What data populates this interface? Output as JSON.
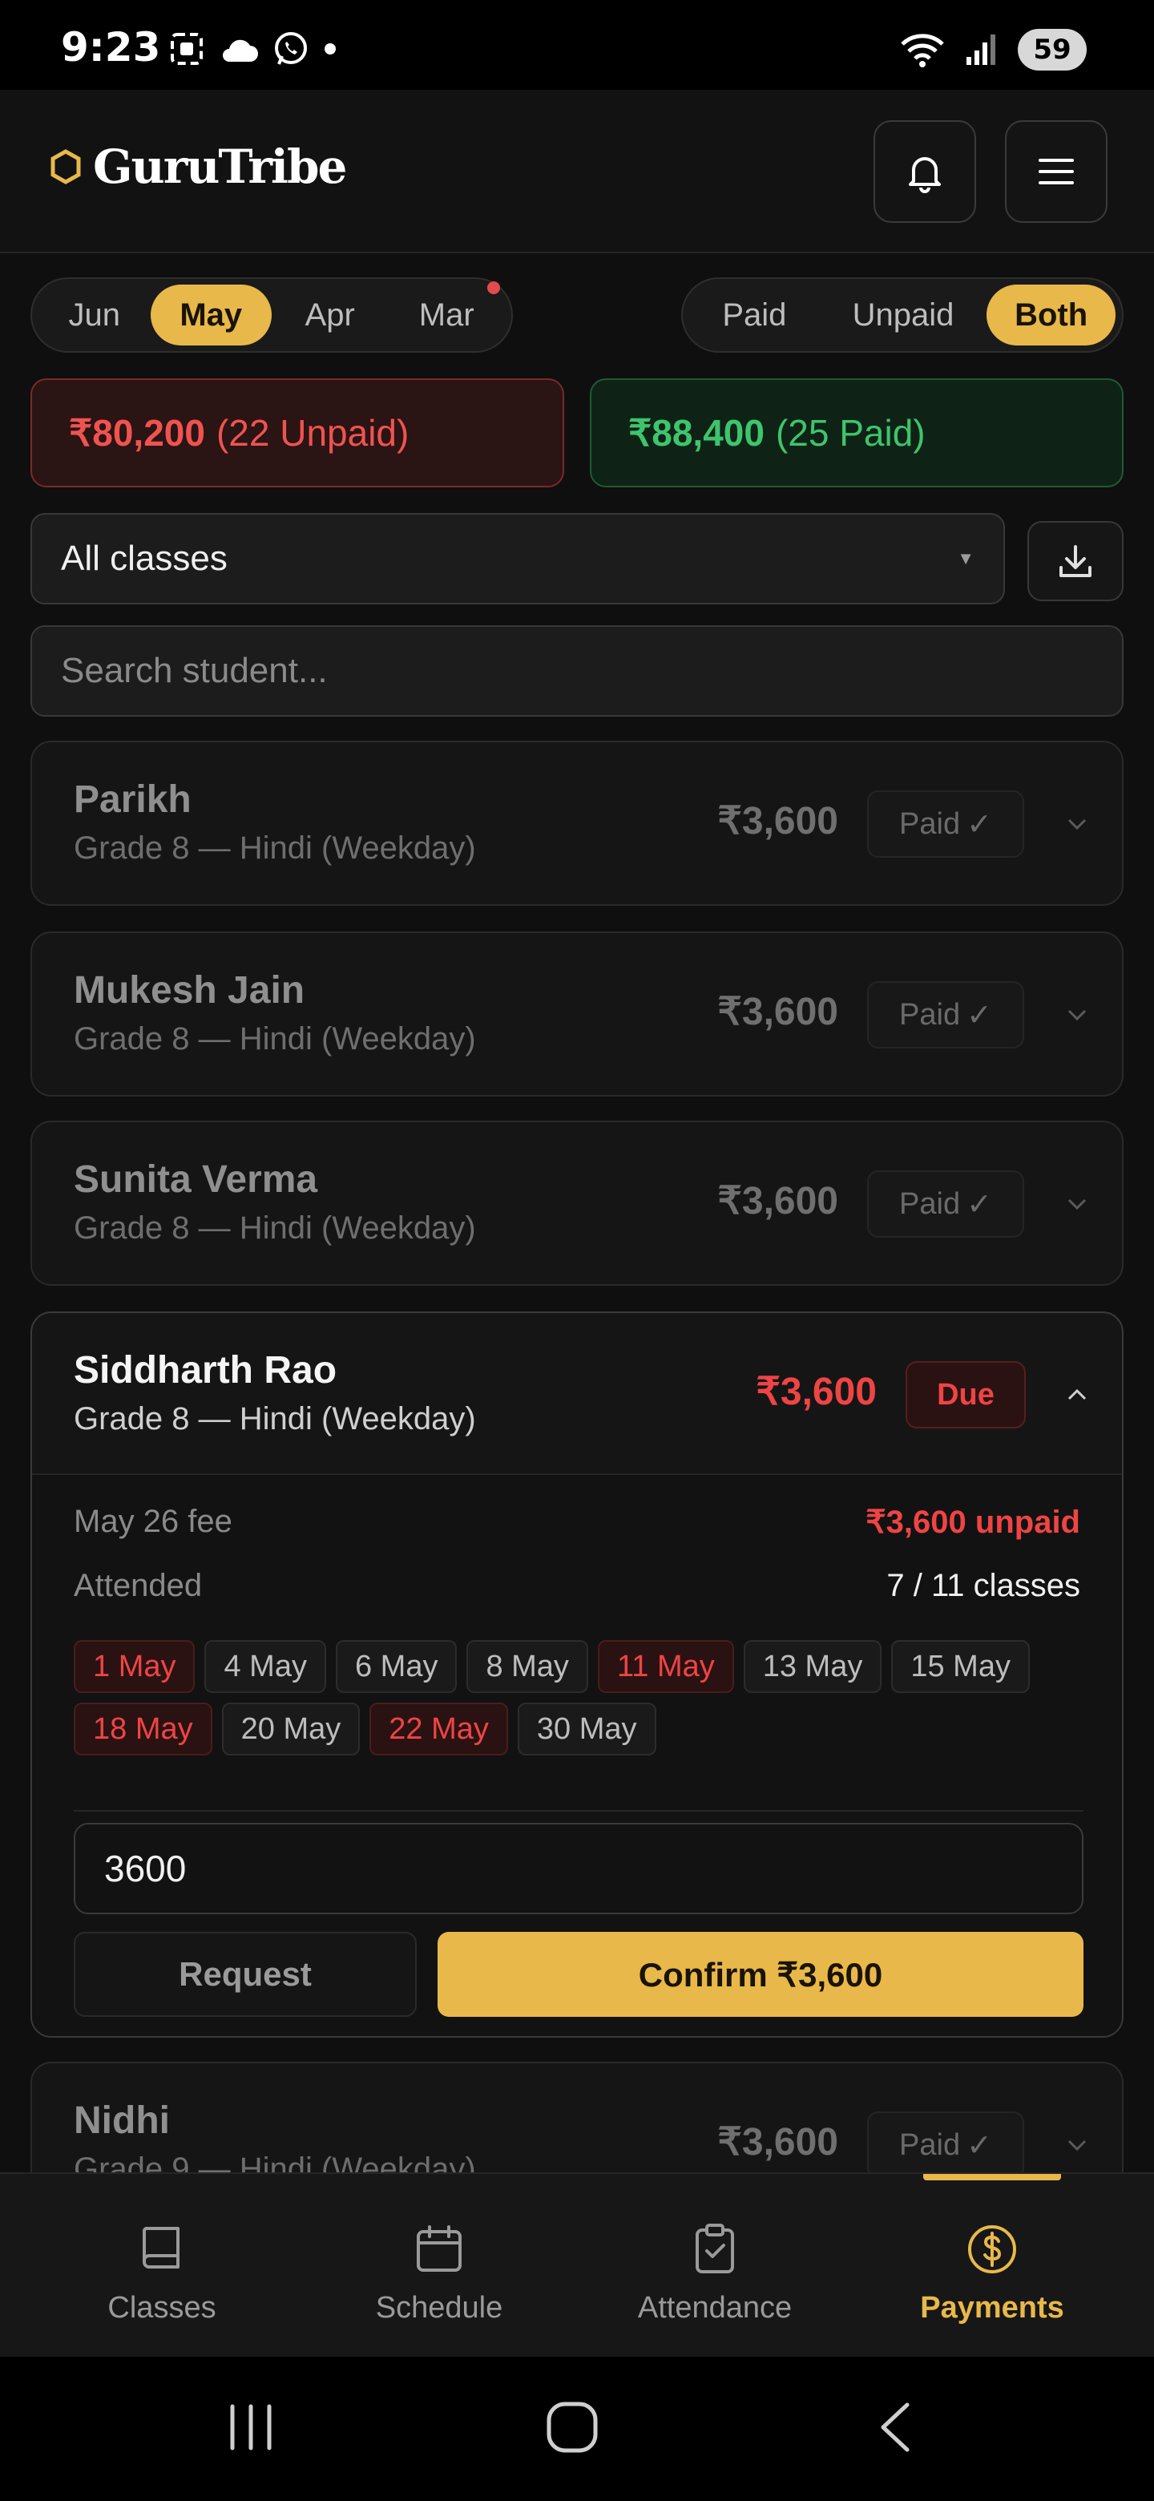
{
  "status_bar": {
    "time": "9:23",
    "battery": "59",
    "wifi_label": "5"
  },
  "app": {
    "name": "GuruTribe"
  },
  "month_tabs": [
    {
      "label": "Jun",
      "active": false
    },
    {
      "label": "May",
      "active": true
    },
    {
      "label": "Apr",
      "active": false
    },
    {
      "label": "Mar",
      "active": false,
      "notification": true
    }
  ],
  "status_filter": [
    {
      "label": "Paid",
      "active": false
    },
    {
      "label": "Unpaid",
      "active": false
    },
    {
      "label": "Both",
      "active": true
    }
  ],
  "summary": {
    "unpaid_amount": "₹80,200",
    "unpaid_count": "(22 Unpaid)",
    "paid_amount": "₹88,400",
    "paid_count": "(25 Paid)"
  },
  "class_select": {
    "value": "All classes"
  },
  "search": {
    "placeholder": "Search student..."
  },
  "students": [
    {
      "name": "Parikh",
      "class": "Grade 8 — Hindi (Weekday)",
      "amount": "₹3,600",
      "status": "Paid"
    },
    {
      "name": "Mukesh Jain",
      "class": "Grade 8 — Hindi (Weekday)",
      "amount": "₹3,600",
      "status": "Paid"
    },
    {
      "name": "Sunita Verma",
      "class": "Grade 8 — Hindi (Weekday)",
      "amount": "₹3,600",
      "status": "Paid"
    },
    {
      "name": "Siddharth Rao",
      "class": "Grade 8 — Hindi (Weekday)",
      "amount": "₹3,600",
      "status": "Due"
    },
    {
      "name": "Nidhi",
      "class": "Grade 9 — Hindi (Weekday)",
      "amount": "₹3,600",
      "status": "Paid"
    }
  ],
  "expanded": {
    "fee_label": "May 26 fee",
    "fee_value": "₹3,600 unpaid",
    "attended_label": "Attended",
    "attended_value": "7 / 11 classes",
    "dates": [
      {
        "label": "1 May",
        "absent": true
      },
      {
        "label": "4 May",
        "absent": false
      },
      {
        "label": "6 May",
        "absent": false
      },
      {
        "label": "8 May",
        "absent": false
      },
      {
        "label": "11 May",
        "absent": true
      },
      {
        "label": "13 May",
        "absent": false
      },
      {
        "label": "15 May",
        "absent": false
      },
      {
        "label": "18 May",
        "absent": true
      },
      {
        "label": "20 May",
        "absent": false
      },
      {
        "label": "22 May",
        "absent": true
      },
      {
        "label": "30 May",
        "absent": false
      }
    ],
    "amount_input": "3600",
    "request_label": "Request",
    "confirm_label": "Confirm ₹3,600"
  },
  "bottom_nav": [
    {
      "label": "Classes",
      "icon": "book-icon",
      "active": false
    },
    {
      "label": "Schedule",
      "icon": "calendar-icon",
      "active": false
    },
    {
      "label": "Attendance",
      "icon": "clipboard-check-icon",
      "active": false
    },
    {
      "label": "Payments",
      "icon": "dollar-circle-icon",
      "active": true
    }
  ],
  "colors": {
    "accent": "#e8b84a",
    "unpaid": "#ef4444",
    "paid": "#3ec46d",
    "background": "#0f0f0f"
  }
}
